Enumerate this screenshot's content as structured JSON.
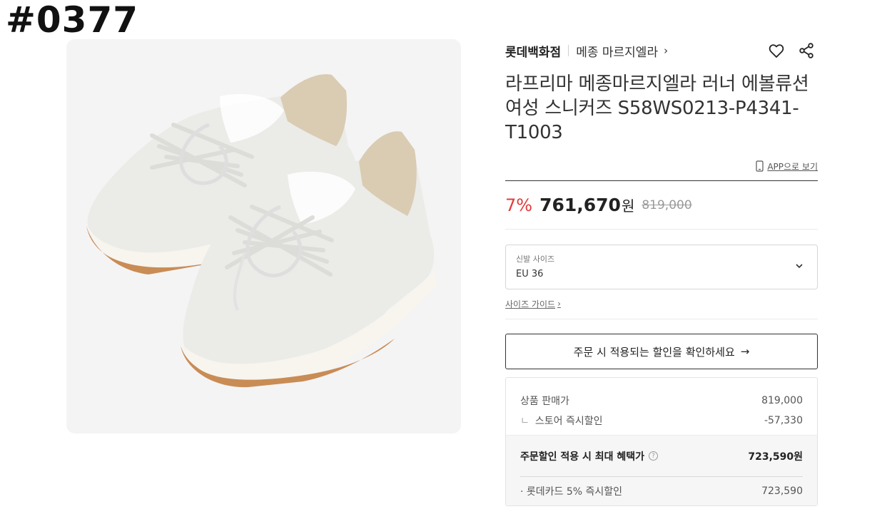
{
  "tag": "#0377",
  "product_image": {
    "alt": "white nylon sneakers with gum sole",
    "colors": {
      "sole": "#c98c55",
      "upper": "#ededea",
      "lining": "#d9ccb2"
    }
  },
  "brand_row": {
    "store": "롯데백화점",
    "brand": "메종 마르지엘라",
    "chevron": "›",
    "wishlist_icon": "heart-icon",
    "share_icon": "share-icon"
  },
  "product": {
    "title": "라프리마 메종마르지엘라 러너 에볼류션 여성 스니커즈 S58WS0213-P4341-T1003"
  },
  "app_link": {
    "label": "APP으로 보기",
    "icon": "mobile-icon"
  },
  "price": {
    "discount": "7%",
    "sale": "761,670",
    "currency": "원",
    "original": "819,000",
    "discount_color": "#e33b3b"
  },
  "size_select": {
    "label": "신발 사이즈",
    "value": "EU 36"
  },
  "size_guide": {
    "label": "사이즈 가이드",
    "arrow": "›"
  },
  "coupon": {
    "label": "주문 시 적용되는 할인을 확인하세요",
    "arrow": "→"
  },
  "benefits": {
    "sale_price_label": "상품 판매가",
    "sale_price_value": "819,000",
    "instant_mark": "ㄴ",
    "instant_label": "스토어 즉시할인",
    "instant_value": "-57,330",
    "max_label": "주문할인 적용 시 최대 혜택가",
    "max_info": "?",
    "max_value": "723,590원",
    "card_label": "· 롯데카드 5% 즉시할인",
    "card_value": "723,590"
  }
}
